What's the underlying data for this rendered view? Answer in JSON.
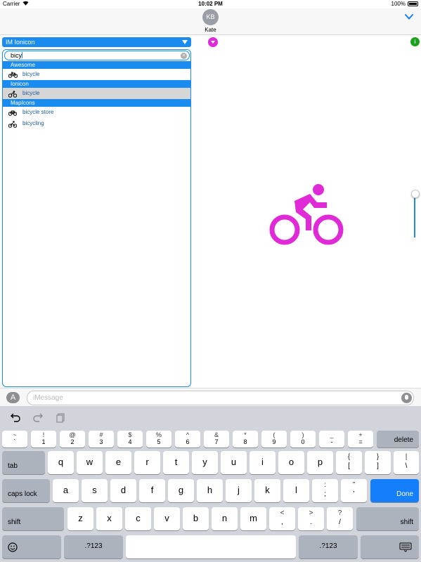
{
  "status_bar": {
    "carrier": "Carrier",
    "time": "10:02 PM",
    "battery": "100%"
  },
  "header": {
    "avatar_initials": "KB",
    "contact_name": "Kate"
  },
  "icon_set_selector": {
    "label": "IM Ionicon"
  },
  "search": {
    "value": "bicy"
  },
  "results": {
    "groups": [
      {
        "header": "Awesome",
        "items": [
          {
            "label": "bicycle",
            "selected": false
          }
        ]
      },
      {
        "header": "Ionicon",
        "items": [
          {
            "label": "bicycle",
            "selected": true
          }
        ]
      },
      {
        "header": "MapIcons",
        "items": [
          {
            "label": "bicycle store",
            "selected": false
          },
          {
            "label": "bicycling",
            "selected": false
          }
        ]
      }
    ]
  },
  "info_label": "i",
  "preview": {
    "icon": "bicycle-icon",
    "color": "#e02ad8"
  },
  "message_bar": {
    "placeholder": "iMessage"
  },
  "keyboard": {
    "row_numbers": [
      {
        "top": "~",
        "bottom": "`"
      },
      {
        "top": "!",
        "bottom": "1"
      },
      {
        "top": "@",
        "bottom": "2"
      },
      {
        "top": "#",
        "bottom": "3"
      },
      {
        "top": "$",
        "bottom": "4"
      },
      {
        "top": "%",
        "bottom": "5"
      },
      {
        "top": "^",
        "bottom": "6"
      },
      {
        "top": "&",
        "bottom": "7"
      },
      {
        "top": "*",
        "bottom": "8"
      },
      {
        "top": "(",
        "bottom": "9"
      },
      {
        "top": ")",
        "bottom": "0"
      },
      {
        "top": "_",
        "bottom": "-"
      },
      {
        "top": "+",
        "bottom": "="
      }
    ],
    "delete_label": "delete",
    "tab_label": "tab",
    "row_q": [
      "q",
      "w",
      "e",
      "r",
      "t",
      "y",
      "u",
      "i",
      "o",
      "p"
    ],
    "bracket_keys": [
      {
        "top": "{",
        "bottom": "["
      },
      {
        "top": "}",
        "bottom": "]"
      },
      {
        "top": "|",
        "bottom": "\\"
      }
    ],
    "caps_label": "caps lock",
    "row_a": [
      "a",
      "s",
      "d",
      "f",
      "g",
      "h",
      "j",
      "k",
      "l"
    ],
    "punct_a": [
      {
        "top": ":",
        "bottom": ";"
      },
      {
        "top": "”",
        "bottom": "’"
      }
    ],
    "done_label": "Done",
    "shift_label": "shift",
    "row_z": [
      "z",
      "x",
      "c",
      "v",
      "b",
      "n",
      "m"
    ],
    "punct_z": [
      {
        "top": "<",
        "bottom": ","
      },
      {
        "top": ">",
        "bottom": "."
      },
      {
        "top": "?",
        "bottom": "/"
      }
    ],
    "numbers_label": ".?123"
  }
}
